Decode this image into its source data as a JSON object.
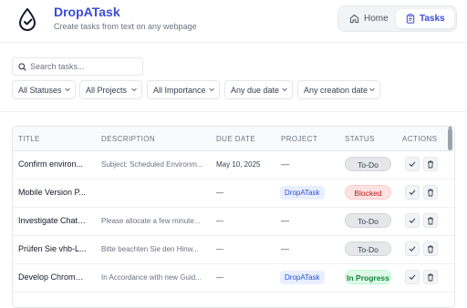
{
  "header": {
    "title": "DropATask",
    "subtitle": "Create tasks from text on any webpage",
    "nav": [
      {
        "label": "Home",
        "icon": "home-icon"
      },
      {
        "label": "Tasks",
        "icon": "clipboard-icon",
        "active": true
      }
    ]
  },
  "search": {
    "placeholder": "Search tasks...",
    "value": ""
  },
  "filters": [
    {
      "label": "All Statuses"
    },
    {
      "label": "All Projects"
    },
    {
      "label": "All Importance"
    },
    {
      "label": "Any due date"
    },
    {
      "label": "Any creation date"
    }
  ],
  "table": {
    "columns": [
      "TITLE",
      "DESCRIPTION",
      "DUE DATE",
      "PROJECT",
      "STATUS",
      "ACTIONS"
    ],
    "rows": [
      {
        "title": "Confirm environ...",
        "description": "Subject: Scheduled Environm...",
        "due": "May 10, 2025",
        "project": "—",
        "status": "To-Do"
      },
      {
        "title": "Mobile Version P...",
        "description": "",
        "due": "—",
        "project": "DropATask",
        "status": "Blocked"
      },
      {
        "title": "Investigate Chatb...",
        "description": "Please allocate a few minute...",
        "due": "—",
        "project": "—",
        "status": "To-Do"
      },
      {
        "title": "Prüfen Sie vhb-L...",
        "description": "Bitte beachten Sie den Hinw...",
        "due": "—",
        "project": "—",
        "status": "To-Do"
      },
      {
        "title": "Develop Chrome ...",
        "description": "In Accordance with new Guid...",
        "due": "—",
        "project": "DropATask",
        "status": "In Progress"
      }
    ]
  },
  "colors": {
    "accent": "#3b4bd8",
    "todo": "#e5e7eb",
    "blocked": "#fee2e2",
    "in_progress": "#dcfce7"
  }
}
